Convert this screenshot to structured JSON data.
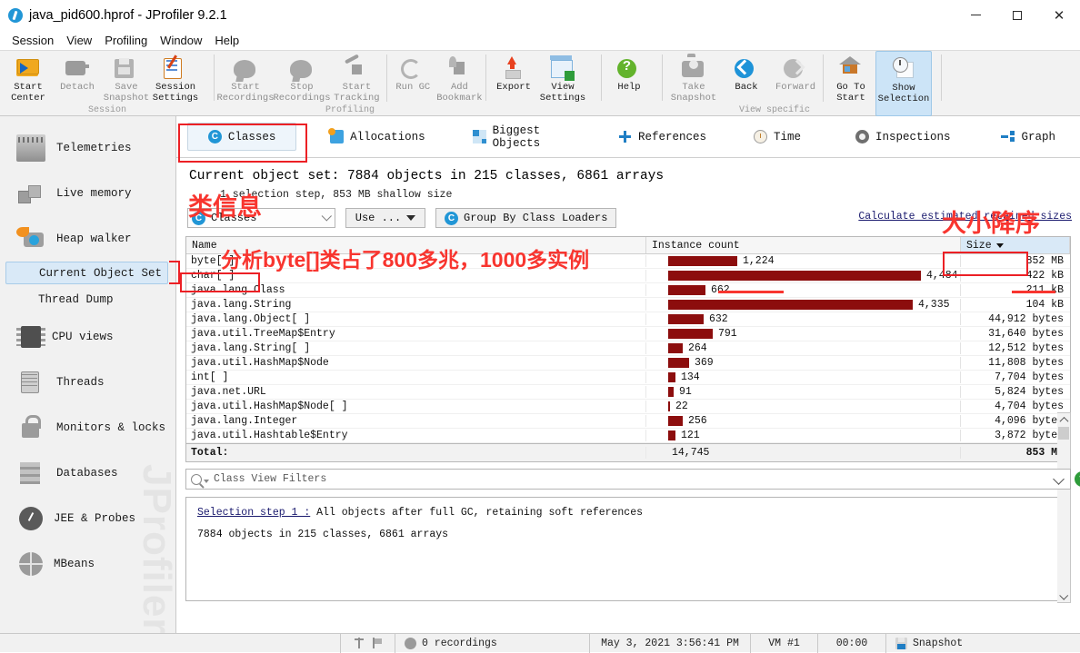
{
  "window": {
    "title": "java_pid600.hprof - JProfiler 9.2.1",
    "app_icon": "jprofiler-icon",
    "minimize": "—",
    "maximize": "□",
    "close": "✕"
  },
  "menu": [
    "Session",
    "View",
    "Profiling",
    "Window",
    "Help"
  ],
  "toolbar": {
    "groups": [
      {
        "label": "Session",
        "buttons": [
          {
            "icon": "start-center-icon",
            "lines": [
              "Start",
              "Center"
            ],
            "enabled": true
          },
          {
            "icon": "detach-icon",
            "lines": [
              "Detach"
            ],
            "enabled": false
          },
          {
            "icon": "save-snapshot-icon",
            "lines": [
              "Save",
              "Snapshot"
            ],
            "enabled": false
          },
          {
            "icon": "session-settings-icon",
            "lines": [
              "Session",
              "Settings"
            ],
            "enabled": true
          }
        ]
      },
      {
        "label": "Profiling",
        "buttons": [
          {
            "icon": "start-recordings-icon",
            "lines": [
              "Start",
              "Recordings"
            ],
            "enabled": false
          },
          {
            "icon": "stop-recordings-icon",
            "lines": [
              "Stop",
              "Recordings"
            ],
            "enabled": false
          },
          {
            "icon": "start-tracking-icon",
            "lines": [
              "Start",
              "Tracking"
            ],
            "enabled": false
          },
          {
            "icon": "run-gc-icon",
            "lines": [
              "Run GC"
            ],
            "enabled": false
          },
          {
            "icon": "add-bookmark-icon",
            "lines": [
              "Add",
              "Bookmark"
            ],
            "enabled": false
          }
        ]
      },
      {
        "label": "",
        "buttons": [
          {
            "icon": "export-icon",
            "lines": [
              "Export"
            ],
            "enabled": true
          },
          {
            "icon": "view-settings-icon",
            "lines": [
              "View",
              "Settings"
            ],
            "enabled": true
          }
        ]
      },
      {
        "label": "",
        "buttons": [
          {
            "icon": "help-icon",
            "lines": [
              "Help"
            ],
            "enabled": true
          }
        ]
      },
      {
        "label": "View specific",
        "buttons": [
          {
            "icon": "take-snapshot-icon",
            "lines": [
              "Take",
              "Snapshot"
            ],
            "enabled": false
          },
          {
            "icon": "back-icon",
            "lines": [
              "Back"
            ],
            "enabled": true
          },
          {
            "icon": "forward-icon",
            "lines": [
              "Forward"
            ],
            "enabled": false
          },
          {
            "icon": "go-to-start-icon",
            "lines": [
              "Go To",
              "Start"
            ],
            "enabled": true
          },
          {
            "icon": "show-selection-icon",
            "lines": [
              "Show",
              "Selection"
            ],
            "enabled": true,
            "selected": true
          }
        ]
      }
    ]
  },
  "sidebar": {
    "items": [
      {
        "icon": "telemetries-icon",
        "label": "Telemetries"
      },
      {
        "icon": "live-memory-icon",
        "label": "Live memory"
      },
      {
        "icon": "heap-walker-icon",
        "label": "Heap walker"
      }
    ],
    "sub_items": [
      {
        "label": "Current Object Set",
        "active": true
      },
      {
        "label": "Thread Dump",
        "active": false
      }
    ],
    "items2": [
      {
        "icon": "cpu-views-icon",
        "label": "CPU views"
      },
      {
        "icon": "threads-icon",
        "label": "Threads"
      },
      {
        "icon": "monitors-locks-icon",
        "label": "Monitors & locks"
      },
      {
        "icon": "databases-icon",
        "label": "Databases"
      },
      {
        "icon": "jee-probes-icon",
        "label": "JEE & Probes"
      },
      {
        "icon": "mbeans-icon",
        "label": "MBeans"
      }
    ],
    "watermark": "JProfiler"
  },
  "tabs": [
    {
      "icon": "classes-icon",
      "label": "Classes",
      "active": true
    },
    {
      "icon": "allocations-icon",
      "label": "Allocations",
      "active": false
    },
    {
      "icon": "biggest-objects-icon",
      "label": "Biggest Objects",
      "active": false
    },
    {
      "icon": "references-icon",
      "label": "References",
      "active": false
    },
    {
      "icon": "time-icon",
      "label": "Time",
      "active": false
    },
    {
      "icon": "inspections-icon",
      "label": "Inspections",
      "active": false
    },
    {
      "icon": "graph-icon",
      "label": "Graph",
      "active": false
    }
  ],
  "object_set": {
    "headline": "Current object set: 7884 objects in 215 classes, 6861 arrays",
    "subline": "1 selection step, 853 MB shallow size"
  },
  "controls": {
    "view_select": "Classes",
    "use_button": "Use ...",
    "group_button": "Group By Class Loaders",
    "retained_link": "Calculate estimated retained sizes"
  },
  "table": {
    "headers": {
      "name": "Name",
      "count": "Instance count",
      "size": "Size"
    },
    "sort_column": "Size",
    "sort_direction": "descending",
    "rows": [
      {
        "name": "byte[ ]",
        "count": "1,224",
        "count_value": 1224,
        "size": "852 MB"
      },
      {
        "name": "char[ ]",
        "count": "4,484",
        "count_value": 4484,
        "size": "422 kB"
      },
      {
        "name": "java.lang.Class",
        "count": "662",
        "count_value": 662,
        "size": "211 kB"
      },
      {
        "name": "java.lang.String",
        "count": "4,335",
        "count_value": 4335,
        "size": "104 kB"
      },
      {
        "name": "java.lang.Object[ ]",
        "count": "632",
        "count_value": 632,
        "size": "44,912 bytes"
      },
      {
        "name": "java.util.TreeMap$Entry",
        "count": "791",
        "count_value": 791,
        "size": "31,640 bytes"
      },
      {
        "name": "java.lang.String[ ]",
        "count": "264",
        "count_value": 264,
        "size": "12,512 bytes"
      },
      {
        "name": "java.util.HashMap$Node",
        "count": "369",
        "count_value": 369,
        "size": "11,808 bytes"
      },
      {
        "name": "int[ ]",
        "count": "134",
        "count_value": 134,
        "size": "7,704 bytes"
      },
      {
        "name": "java.net.URL",
        "count": "91",
        "count_value": 91,
        "size": "5,824 bytes"
      },
      {
        "name": "java.util.HashMap$Node[ ]",
        "count": "22",
        "count_value": 22,
        "size": "4,704 bytes"
      },
      {
        "name": "java.lang.Integer",
        "count": "256",
        "count_value": 256,
        "size": "4,096 bytes"
      },
      {
        "name": "java.util.Hashtable$Entry",
        "count": "121",
        "count_value": 121,
        "size": "3,872 bytes"
      }
    ],
    "total": {
      "name": "Total:",
      "count": "14,745",
      "size": "853 MB"
    }
  },
  "chart_data": {
    "type": "bar",
    "title": "Instance count",
    "orientation": "horizontal",
    "categories": [
      "byte[ ]",
      "char[ ]",
      "java.lang.Class",
      "java.lang.String",
      "java.lang.Object[ ]",
      "java.util.TreeMap$Entry",
      "java.lang.String[ ]",
      "java.util.HashMap$Node",
      "int[ ]",
      "java.net.URL",
      "java.util.HashMap$Node[ ]",
      "java.lang.Integer",
      "java.util.Hashtable$Entry"
    ],
    "values": [
      1224,
      4484,
      662,
      4335,
      632,
      791,
      264,
      369,
      134,
      91,
      22,
      256,
      121
    ],
    "bar_color": "#8c0d0d",
    "xlabel": "Instance count",
    "ylabel": "",
    "xlim": [
      0,
      4484
    ],
    "grid": false,
    "legend": "none"
  },
  "filter": {
    "placeholder": "Class View Filters",
    "value": ""
  },
  "steps": {
    "link": "Selection step 1 :",
    "text": "All objects after full GC, retaining soft references",
    "summary": "7884 objects in 215 classes, 6861 arrays"
  },
  "statusbar": {
    "recordings": "0 recordings",
    "timestamp": "May 3, 2021 3:56:41 PM",
    "vm": "VM #1",
    "elapsed": "00:00",
    "snapshot": "Snapshot"
  },
  "annotations": {
    "class_info": "类信息",
    "analysis": "分析byte[]类占了800多兆，1000多实例",
    "size_desc": "大小降序"
  },
  "colors": {
    "accent_blue": "#2196d6",
    "bar_red": "#8c0d0d",
    "annotation_red": "#f8352f",
    "selection_blue": "#d9e9f7"
  }
}
